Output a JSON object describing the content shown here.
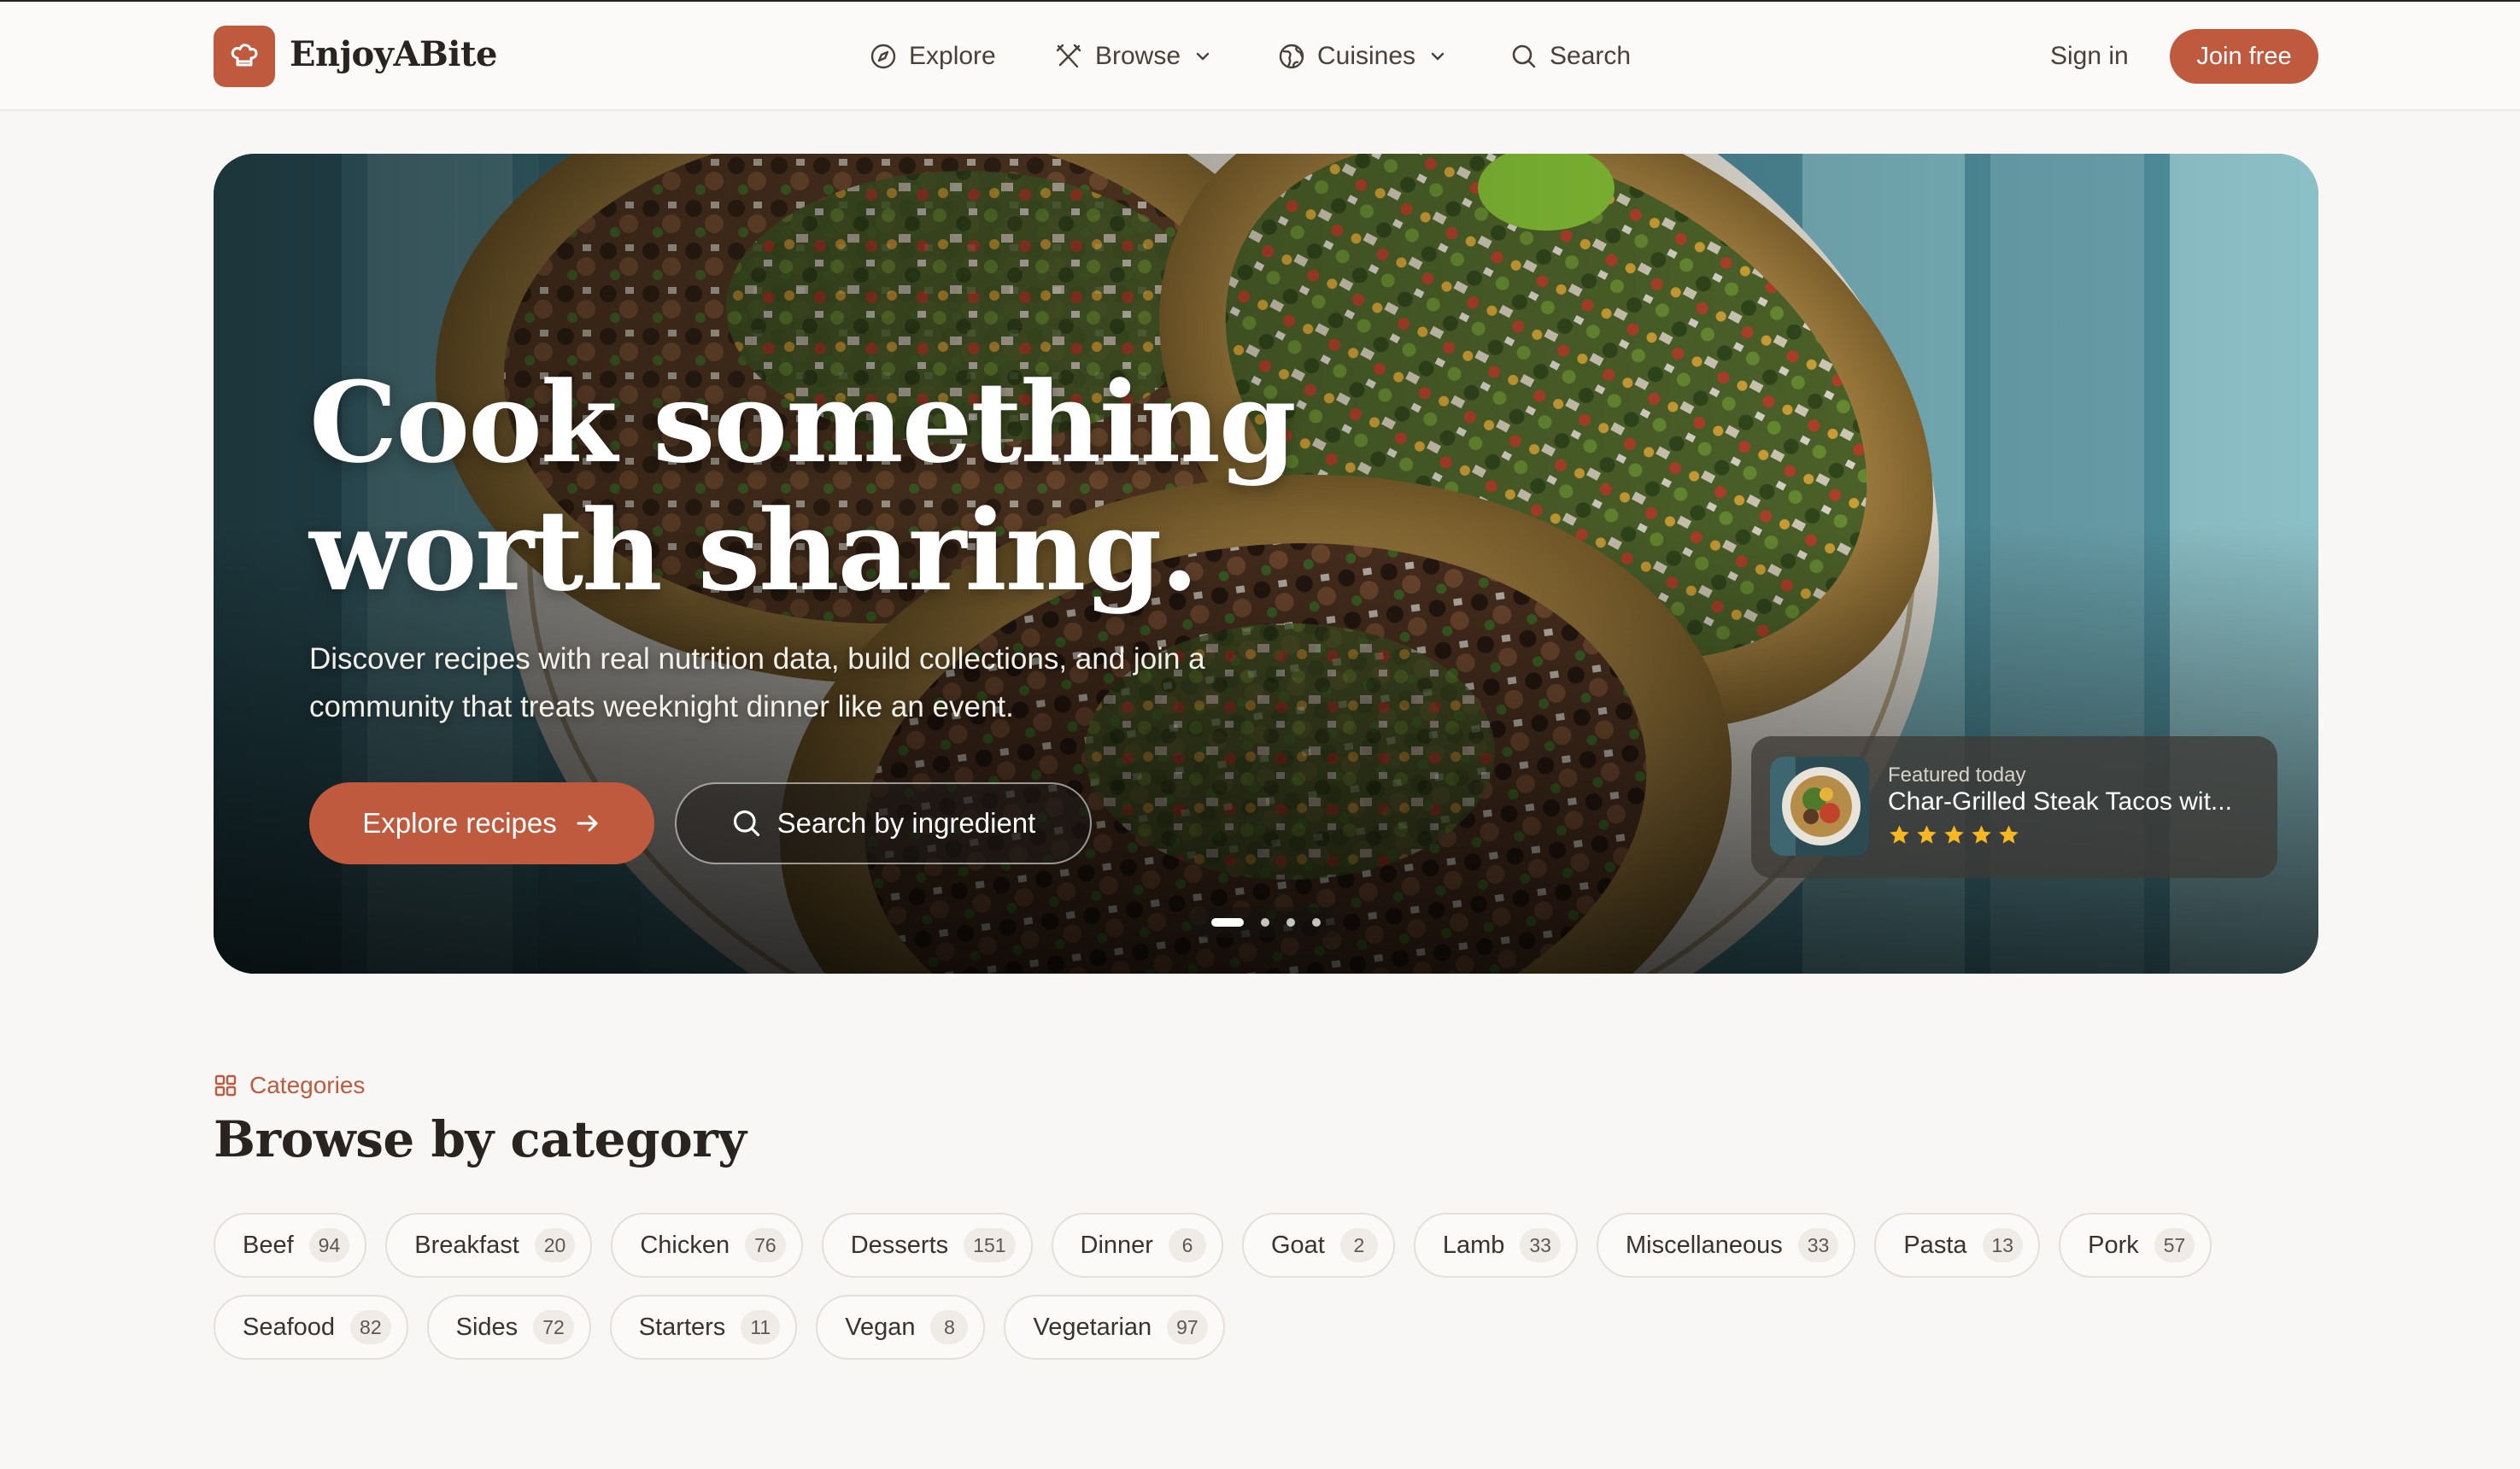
{
  "brand": {
    "name": "EnjoyABite",
    "icon": "chef-hat-icon",
    "accent_color": "#c05a3f"
  },
  "nav": {
    "explore": "Explore",
    "browse": "Browse",
    "cuisines": "Cuisines",
    "search": "Search",
    "sign_in": "Sign in",
    "join": "Join free"
  },
  "hero": {
    "title": "Cook something worth sharing.",
    "subtitle": "Discover recipes with real nutrition data, build collections, and join a community that treats weeknight dinner like an event.",
    "primary_button": "Explore recipes",
    "secondary_button": "Search by ingredient",
    "slide_count": 4,
    "active_slide": 1,
    "featured": {
      "label": "Featured today",
      "title": "Char-Grilled Steak Tacos wit...",
      "rating": 5
    }
  },
  "categories": {
    "eyebrow": "Categories",
    "heading": "Browse by category",
    "items": [
      {
        "name": "Beef",
        "count": "94"
      },
      {
        "name": "Breakfast",
        "count": "20"
      },
      {
        "name": "Chicken",
        "count": "76"
      },
      {
        "name": "Desserts",
        "count": "151"
      },
      {
        "name": "Dinner",
        "count": "6"
      },
      {
        "name": "Goat",
        "count": "2"
      },
      {
        "name": "Lamb",
        "count": "33"
      },
      {
        "name": "Miscellaneous",
        "count": "33"
      },
      {
        "name": "Pasta",
        "count": "13"
      },
      {
        "name": "Pork",
        "count": "57"
      },
      {
        "name": "Seafood",
        "count": "82"
      },
      {
        "name": "Sides",
        "count": "72"
      },
      {
        "name": "Starters",
        "count": "11"
      },
      {
        "name": "Vegan",
        "count": "8"
      },
      {
        "name": "Vegetarian",
        "count": "97"
      }
    ]
  }
}
